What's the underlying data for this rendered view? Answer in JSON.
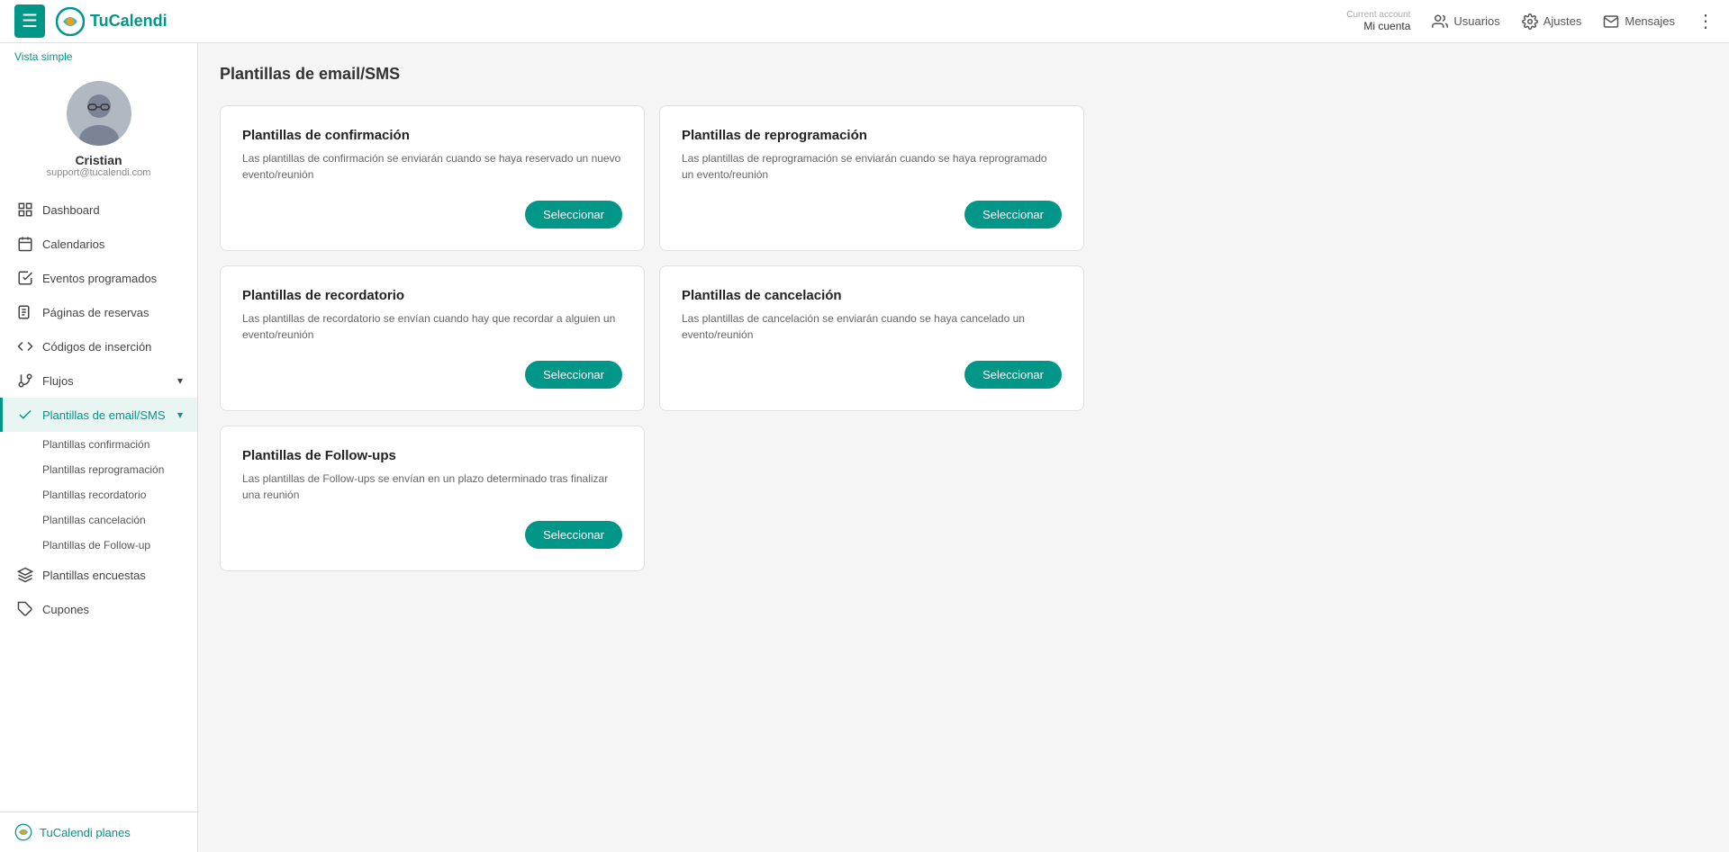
{
  "topnav": {
    "hamburger_label": "☰",
    "logo_text": "TuCalendi",
    "current_account_label": "Current account",
    "account_name": "Mi cuenta",
    "usuarios_label": "Usuarios",
    "ajustes_label": "Ajustes",
    "mensajes_label": "Mensajes",
    "more_label": "⋮"
  },
  "sidebar": {
    "vista_simple": "Vista simple",
    "user_name": "Cristian",
    "user_email": "support@tucalendi.com",
    "nav_items": [
      {
        "id": "dashboard",
        "label": "Dashboard",
        "icon": "grid"
      },
      {
        "id": "calendarios",
        "label": "Calendarios",
        "icon": "calendar"
      },
      {
        "id": "eventos",
        "label": "Eventos programados",
        "icon": "check-square"
      },
      {
        "id": "paginas",
        "label": "Páginas de reservas",
        "icon": "file"
      },
      {
        "id": "codigos",
        "label": "Códigos de inserción",
        "icon": "code"
      },
      {
        "id": "flujos",
        "label": "Flujos",
        "icon": "git-branch",
        "has_arrow": true
      },
      {
        "id": "plantillas",
        "label": "Plantillas de email/SMS",
        "icon": "check",
        "active": true,
        "has_arrow": true
      }
    ],
    "sub_items": [
      {
        "id": "confirmacion",
        "label": "Plantillas confirmación"
      },
      {
        "id": "reprogramacion",
        "label": "Plantillas reprogramación"
      },
      {
        "id": "recordatorio",
        "label": "Plantillas recordatorio"
      },
      {
        "id": "cancelacion",
        "label": "Plantillas cancelación"
      },
      {
        "id": "followup",
        "label": "Plantillas de Follow-up"
      }
    ],
    "after_items": [
      {
        "id": "encuestas",
        "label": "Plantillas encuestas",
        "icon": "layers"
      },
      {
        "id": "cupones",
        "label": "Cupones",
        "icon": "tag"
      }
    ],
    "plans_label": "TuCalendi planes"
  },
  "main": {
    "page_title": "Plantillas de email/SMS",
    "cards": [
      {
        "id": "confirmacion",
        "title": "Plantillas de confirmación",
        "description": "Las plantillas de confirmación se enviarán cuando se haya reservado un nuevo evento/reunión",
        "btn_label": "Seleccionar"
      },
      {
        "id": "reprogramacion",
        "title": "Plantillas de reprogramación",
        "description": "Las plantillas de reprogramación se enviarán cuando se haya reprogramado un evento/reunión",
        "btn_label": "Seleccionar"
      },
      {
        "id": "recordatorio",
        "title": "Plantillas de recordatorio",
        "description": "Las plantillas de recordatorio se envían cuando hay que recordar a alguien un evento/reunión",
        "btn_label": "Seleccionar"
      },
      {
        "id": "cancelacion",
        "title": "Plantillas de cancelación",
        "description": "Las plantillas de cancelación se enviarán cuando se haya cancelado un evento/reunión",
        "btn_label": "Seleccionar"
      },
      {
        "id": "followup",
        "title": "Plantillas de Follow-ups",
        "description": "Las plantillas de Follow-ups se envían en un plazo determinado tras finalizar una reunión",
        "btn_label": "Seleccionar",
        "full_width": false
      }
    ]
  },
  "colors": {
    "primary": "#009688",
    "primary_dark": "#00796b"
  }
}
